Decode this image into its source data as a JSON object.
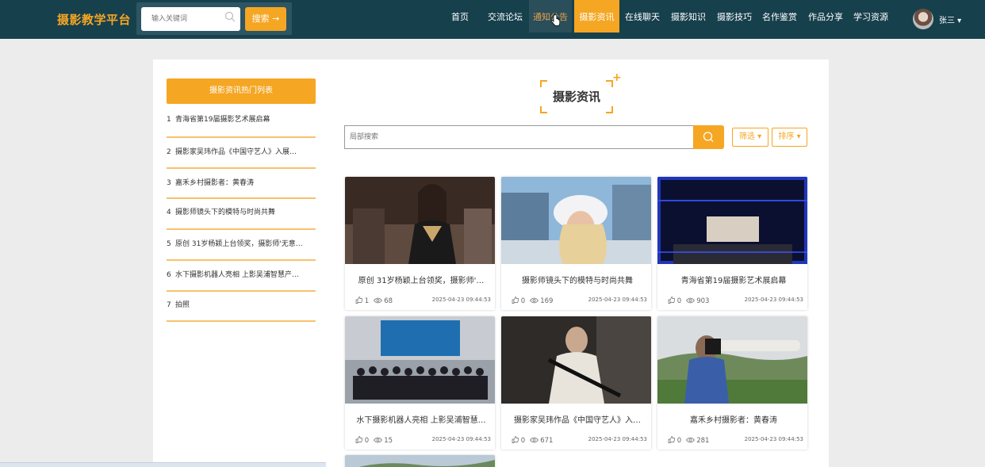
{
  "header": {
    "logo": "摄影教学平台",
    "search_placeholder": "输入关键词",
    "search_button": "搜索 →",
    "nav": [
      {
        "label": "首页"
      },
      {
        "label": "交流论坛"
      },
      {
        "label": "通知公告"
      },
      {
        "label": "摄影资讯"
      },
      {
        "label": "在线聊天"
      },
      {
        "label": "摄影知识"
      },
      {
        "label": "摄影技巧"
      },
      {
        "label": "名作鉴赏"
      },
      {
        "label": "作品分享"
      },
      {
        "label": "学习资源"
      }
    ],
    "active_nav": "摄影资讯",
    "hover_nav": "通知公告",
    "username": "张三 ▾"
  },
  "sidebar": {
    "title": "摄影资讯热门列表",
    "items": [
      {
        "num": "1",
        "label": "青海省第19届摄影艺术展启幕"
      },
      {
        "num": "2",
        "label": "摄影家吴玮作品《中国守艺人》入展…"
      },
      {
        "num": "3",
        "label": "嘉禾乡村摄影者：黄春涛"
      },
      {
        "num": "4",
        "label": "摄影师镜头下的模特与时尚共舞"
      },
      {
        "num": "5",
        "label": "原创 31岁杨颖上台领奖，摄影师'无意…"
      },
      {
        "num": "6",
        "label": "水下摄影机器人亮相 上影吴浦智慧产…"
      },
      {
        "num": "7",
        "label": "拍照"
      }
    ]
  },
  "main": {
    "section_title": "摄影资讯",
    "local_search_placeholder": "局部搜索",
    "filter_label": "筛选 ▾",
    "sort_label": "排序 ▾",
    "cards": [
      {
        "title": "原创 31岁杨颖上台领奖，摄影师'…",
        "likes": "1",
        "views": "68",
        "date": "2025-04-23 09:44:53"
      },
      {
        "title": "摄影师镜头下的模特与时尚共舞",
        "likes": "0",
        "views": "169",
        "date": "2025-04-23 09:44:53"
      },
      {
        "title": "青海省第19届摄影艺术展启幕",
        "likes": "0",
        "views": "903",
        "date": "2025-04-23 09:44:53"
      },
      {
        "title": "水下摄影机器人亮相 上影吴浦智慧…",
        "likes": "0",
        "views": "15",
        "date": "2025-04-23 09:44:53"
      },
      {
        "title": "摄影家吴玮作品《中国守艺人》入…",
        "likes": "0",
        "views": "671",
        "date": "2025-04-23 09:44:53"
      },
      {
        "title": "嘉禾乡村摄影者：黄春涛",
        "likes": "0",
        "views": "281",
        "date": "2025-04-23 09:44:53"
      }
    ]
  },
  "colors": {
    "header_bg": "#17404d",
    "accent": "#f5a623",
    "page_bg": "#ececec"
  }
}
